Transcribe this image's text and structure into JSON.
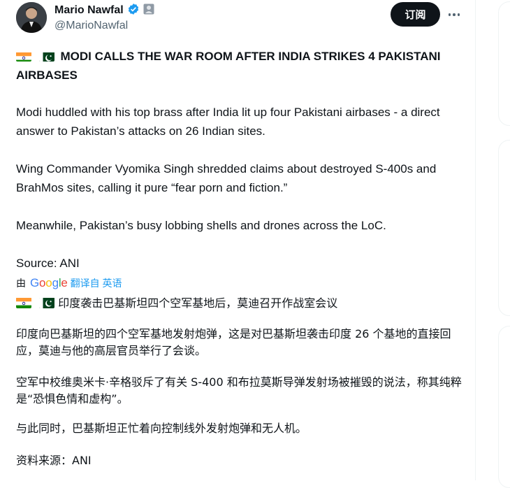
{
  "author": {
    "name": "Mario Nawfal",
    "handle": "@MarioNawfal"
  },
  "actions": {
    "subscribe_label": "订阅"
  },
  "tweet": {
    "headline": "MODI CALLS THE WAR ROOM AFTER INDIA STRIKES 4 PAKISTANI AIRBASES",
    "paragraphs": [
      "Modi huddled with his top brass after India lit up four Pakistani airbases - a direct answer to Pakistan’s attacks on 26 Indian sites.",
      "Wing Commander Vyomika Singh shredded claims about destroyed S-400s and BrahMos sites, calling it pure “fear porn and fiction.”",
      "Meanwhile, Pakistan’s busy lobbing shells and drones across the LoC.",
      "Source: ANI"
    ]
  },
  "translation": {
    "by_label": "由",
    "provider": "Google",
    "link_label": "翻译自 英语",
    "headline": "印度袭击巴基斯坦四个空军基地后，莫迪召开作战室会议",
    "paragraphs": [
      "印度向巴基斯坦的四个空军基地发射炮弹，这是对巴基斯坦袭击印度 26 个基地的直接回应，莫迪与他的高层官员举行了会谈。",
      "空军中校维奥米卡·辛格驳斥了有关 S-400 和布拉莫斯导弹发射场被摧毁的说法，称其纯粹是“恐惧色情和虚构”。",
      "与此同时，巴基斯坦正忙着向控制线外发射炮弹和无人机。",
      "资料来源：ANI"
    ]
  },
  "icons": {
    "verified": "verified-badge-icon",
    "affiliate": "affiliate-badge-icon",
    "more": "more-options-icon",
    "flag_india": "india-flag-icon",
    "flag_pakistan": "pakistan-flag-icon"
  },
  "colors": {
    "text": "#0f1419",
    "secondary": "#536471",
    "accent": "#1d9bf0",
    "button_bg": "#0f1419"
  }
}
